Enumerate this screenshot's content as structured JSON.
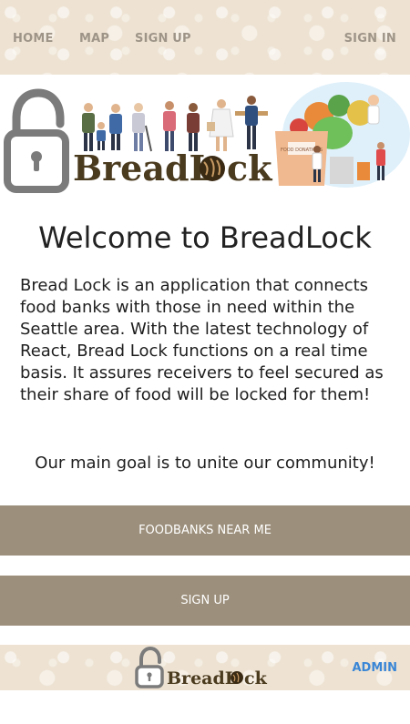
{
  "nav": {
    "home": "HOME",
    "map": "MAP",
    "signup": "SIGN UP",
    "signin": "SIGN IN"
  },
  "hero": {
    "logo_text_left": "BreadL",
    "logo_text_right": "ck",
    "box_label": "FOOD DONATIONS"
  },
  "main": {
    "title": "Welcome to BreadLock",
    "description": "Bread Lock is an application that connects food banks with those in need within the Seattle area. With the latest technology of React, Bread Lock functions on a real time basis. It assures receivers to feel secured as their share of food will be locked for them!",
    "goal": "Our main goal is to unite our community!"
  },
  "buttons": {
    "foodbanks": "FOODBANKS NEAR ME",
    "signup": "SIGN UP"
  },
  "footer": {
    "logo_text_left": "BreadL",
    "logo_text_right": "ck",
    "admin": "ADMIN"
  },
  "colors": {
    "pattern_bg": "#eee3d3",
    "nav_text": "#9e9487",
    "button_bg": "#9c8f7b",
    "admin_link": "#3a86d6",
    "brand_brown": "#4a3a1e"
  },
  "icons": {
    "lock": "unlocked-padlock-icon",
    "bread": "bread-loaf-icon"
  }
}
